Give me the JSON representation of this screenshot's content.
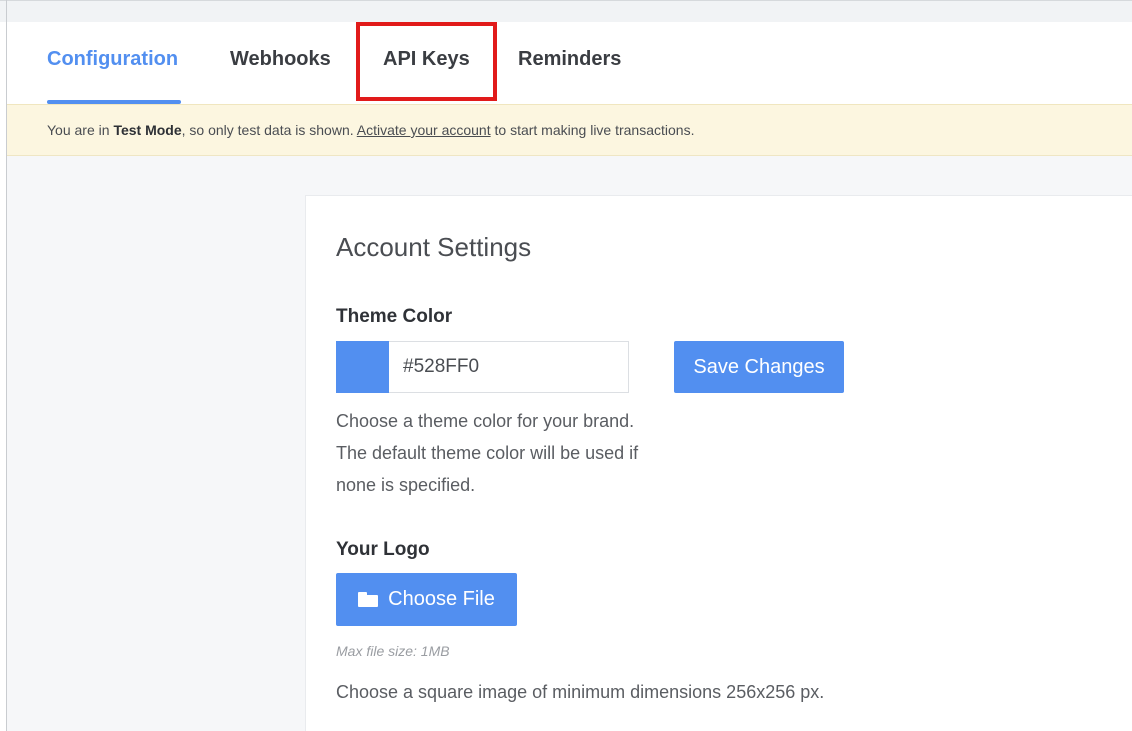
{
  "tabs": [
    {
      "label": "Configuration",
      "active": true
    },
    {
      "label": "Webhooks",
      "active": false
    },
    {
      "label": "API Keys",
      "active": false,
      "highlighted": true
    },
    {
      "label": "Reminders",
      "active": false
    }
  ],
  "banner": {
    "prefix": "You are in ",
    "mode": "Test Mode",
    "middle": ", so only test data is shown. ",
    "link": "Activate your account",
    "suffix": " to start making live transactions."
  },
  "account_settings": {
    "title": "Account Settings",
    "theme_color": {
      "label": "Theme Color",
      "value": "#528FF0",
      "save_label": "Save Changes",
      "help_lines": [
        "Choose a theme color for your brand.",
        "The default theme color will be used if",
        "none is specified."
      ]
    },
    "logo": {
      "label": "Your Logo",
      "choose_label": "Choose File",
      "max_size": "Max file size: 1MB",
      "help": "Choose a square image of minimum dimensions 256x256 px."
    }
  },
  "colors": {
    "accent": "#528FF0",
    "highlight": "#E11A1A",
    "banner_bg": "#FCF6E0"
  },
  "icons": {
    "choose_file": "folder-icon"
  }
}
